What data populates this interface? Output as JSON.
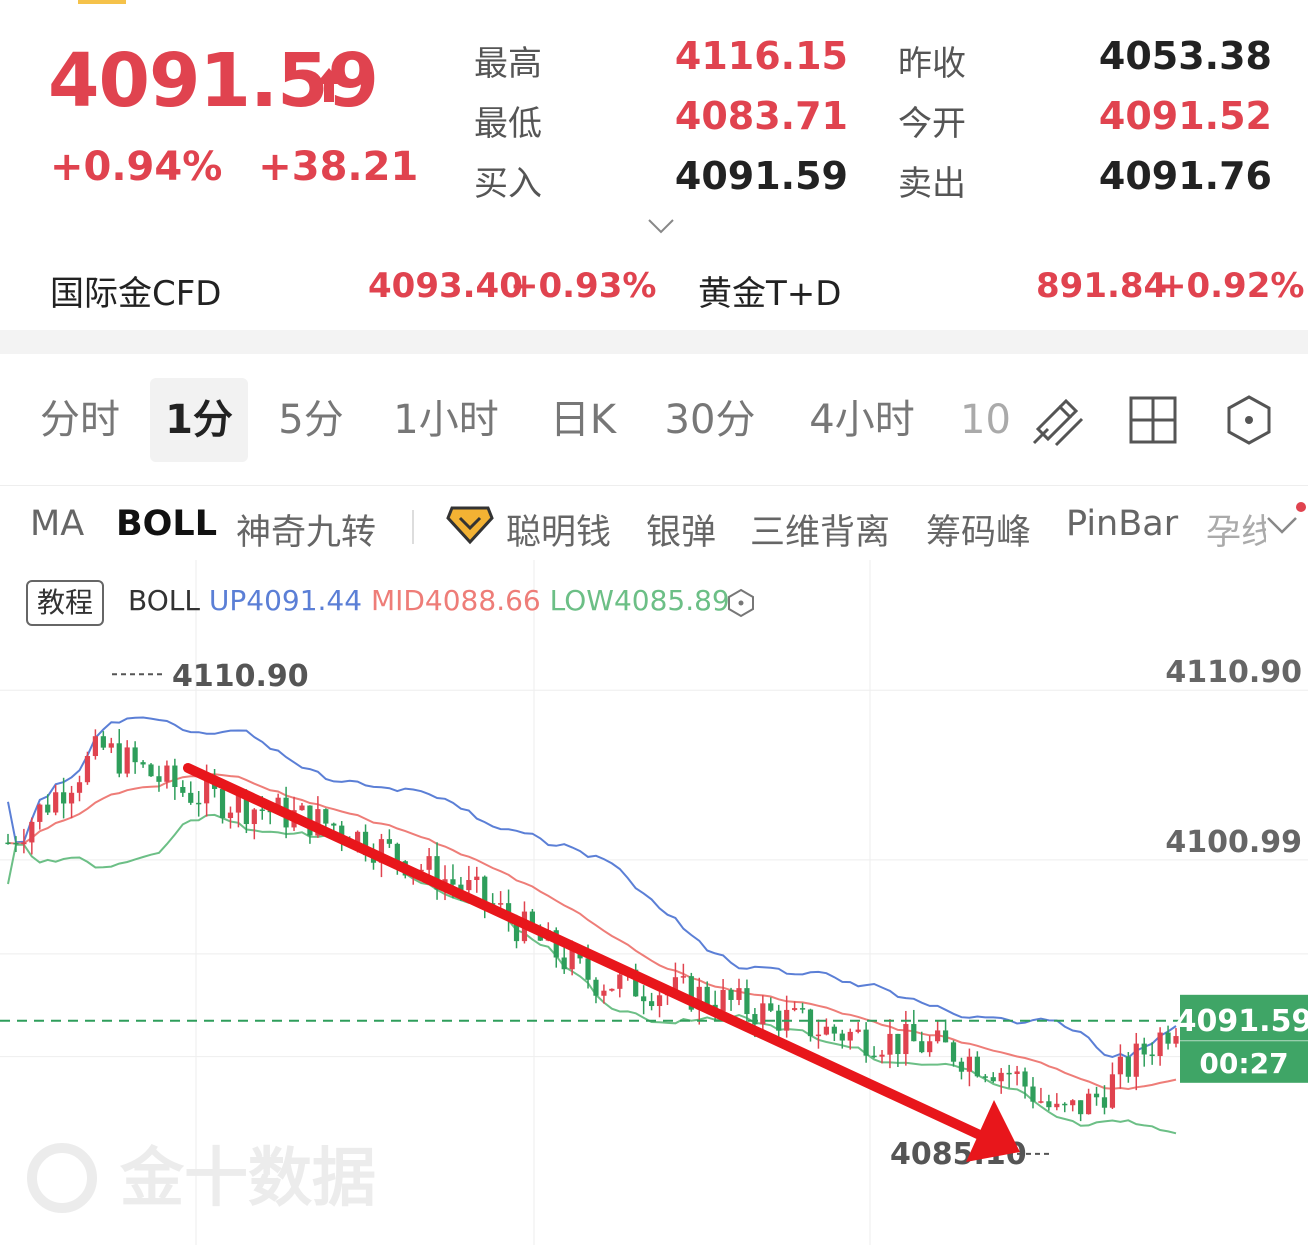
{
  "quote": {
    "price": "4091.59",
    "change_pct": "+0.94%",
    "change_abs": "+38.21",
    "stats": [
      {
        "label": "最高",
        "value": "4116.15",
        "color": "red"
      },
      {
        "label": "昨收",
        "value": "4053.38",
        "color": "dark"
      },
      {
        "label": "最低",
        "value": "4083.71",
        "color": "red"
      },
      {
        "label": "今开",
        "value": "4091.52",
        "color": "red"
      },
      {
        "label": "买入",
        "value": "4091.59",
        "color": "dark"
      },
      {
        "label": "卖出",
        "value": "4091.76",
        "color": "dark"
      }
    ]
  },
  "related": [
    {
      "name": "国际金CFD",
      "price": "4093.40",
      "pct": "+0.93%"
    },
    {
      "name": "黄金T+D",
      "price": "891.84",
      "pct": "+0.92%"
    }
  ],
  "tabs": [
    "分时",
    "1分",
    "5分",
    "1小时",
    "日K",
    "30分",
    "4小时",
    "10"
  ],
  "active_tab": "1分",
  "tools": [
    "draw-tool-icon",
    "layout-grid-icon",
    "settings-hexagon-icon"
  ],
  "indicators": [
    "MA",
    "BOLL",
    "神奇九转",
    "聪明钱",
    "银弹",
    "三维背离",
    "筹码峰",
    "PinBar",
    "孕线"
  ],
  "active_indicator": "BOLL",
  "tutorial_label": "教程",
  "boll": {
    "name": "BOLL",
    "up": "UP4091.44",
    "mid": "MID4088.66",
    "low": "LOW4085.89"
  },
  "colors": {
    "up": "#e0434f",
    "down": "#2e9e5b",
    "boll_up": "#5b7fd6",
    "boll_mid": "#ee7d78",
    "boll_low": "#6cbf86"
  },
  "chart_data": {
    "type": "candlestick",
    "y_ticks": [
      "4110.90",
      "4100.99"
    ],
    "high_marker": "4110.90",
    "low_marker": "4085.10",
    "current_price": "4091.59",
    "countdown": "00:27",
    "ylim": [
      4082,
      4115
    ]
  },
  "watermark": "金十数据"
}
